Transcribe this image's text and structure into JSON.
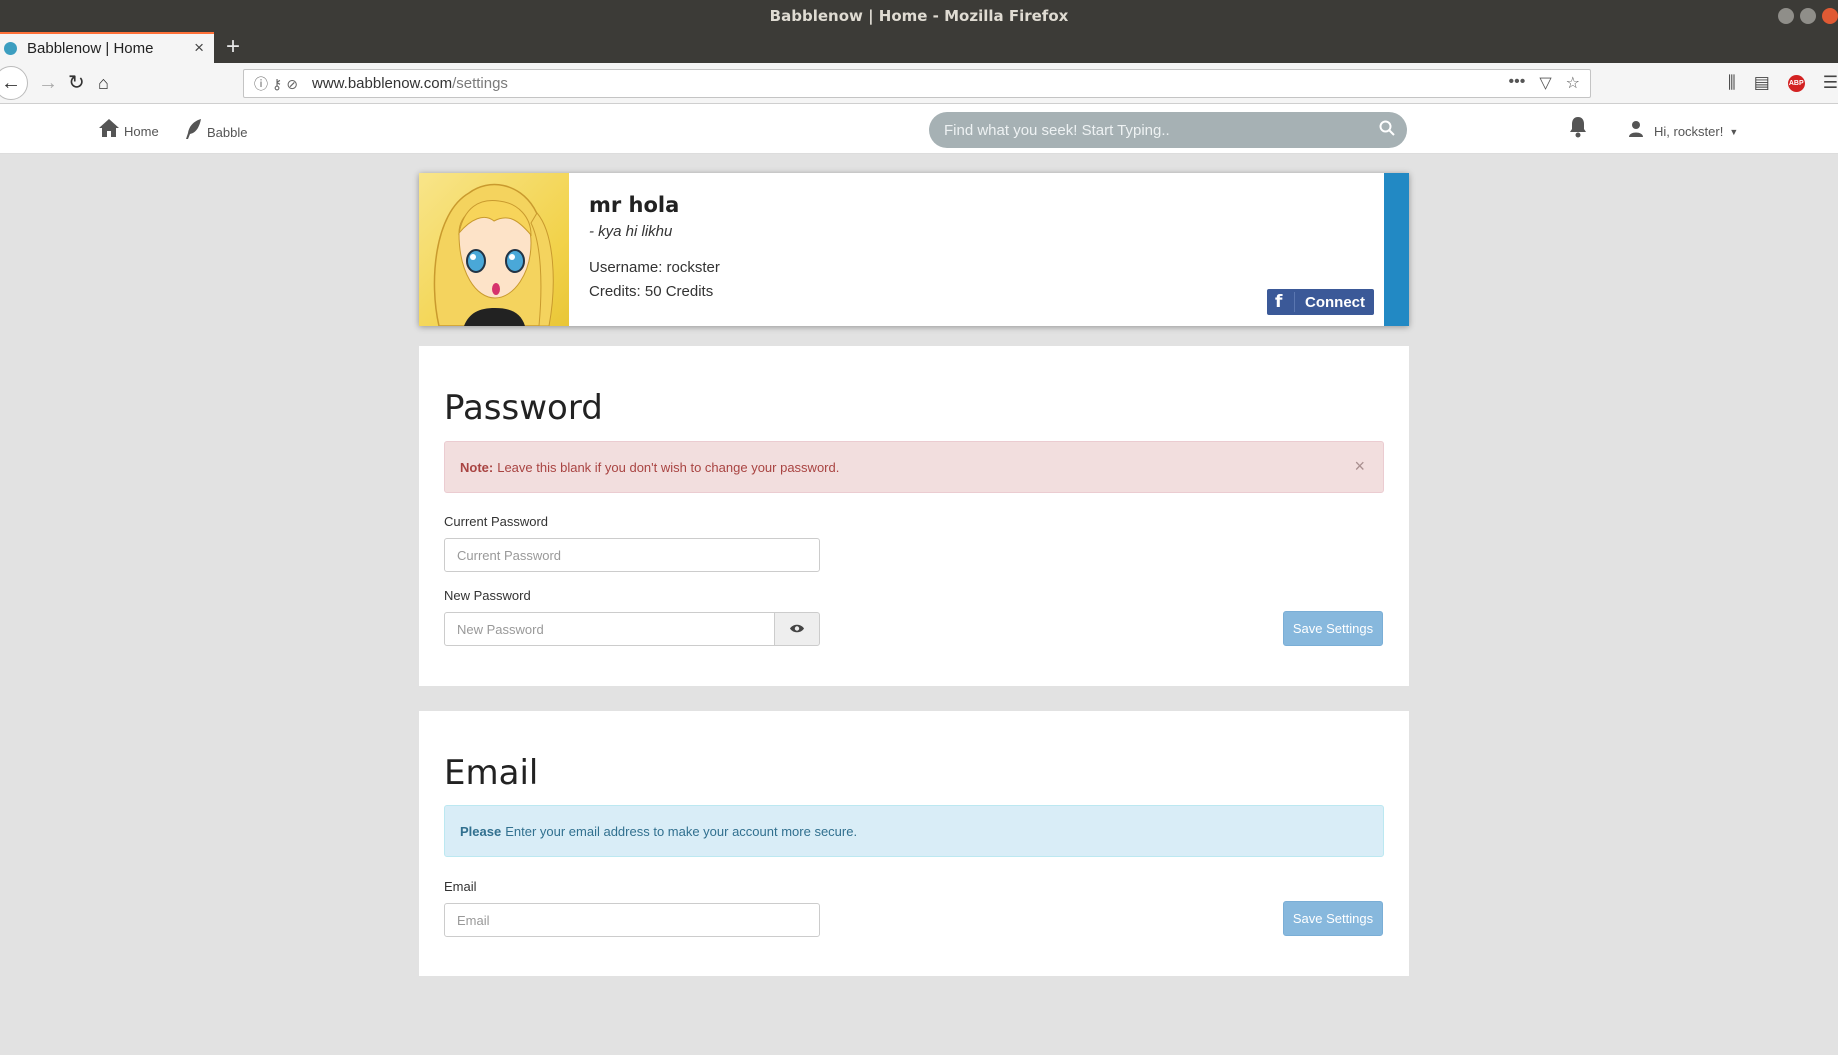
{
  "browser": {
    "window_title": "Babblenow | Home - Mozilla Firefox",
    "tab_title": "Babblenow | Home",
    "url_host": "www.babblenow.com",
    "url_path": "/settings"
  },
  "header": {
    "nav": [
      {
        "label": "Home",
        "icon": "home-icon"
      },
      {
        "label": "Babble",
        "icon": "feather-icon"
      }
    ],
    "search_placeholder": "Find what you seek! Start Typing..",
    "user_greeting": "Hi, rockster!"
  },
  "profile": {
    "name": "mr hola",
    "tagline": "- kya hi likhu",
    "username_line": "Username: rockster",
    "credits_line": "Credits: 50 Credits",
    "connect_label": "Connect",
    "accent_color": "#2289c4"
  },
  "password_panel": {
    "title": "Password",
    "note_strong": "Note:",
    "note_text": "Leave this blank if you don't wish to change your password.",
    "current_label": "Current Password",
    "current_placeholder": "Current Password",
    "new_label": "New Password",
    "new_placeholder": "New Password",
    "save_label": "Save Settings"
  },
  "email_panel": {
    "title": "Email",
    "info_strong": "Please",
    "info_text": "Enter your email address to make your account more secure.",
    "email_label": "Email",
    "email_placeholder": "Email",
    "save_label": "Save Settings"
  }
}
